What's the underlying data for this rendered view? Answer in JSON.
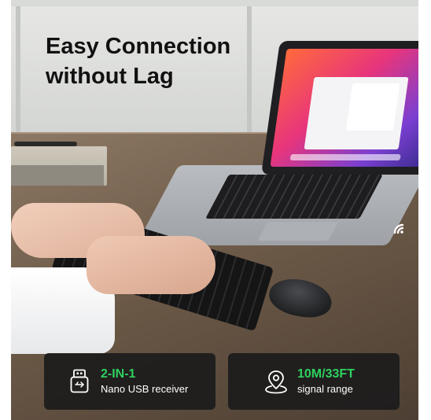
{
  "headline": {
    "line1": "Easy Connection",
    "line2": "without Lag"
  },
  "features": [
    {
      "title": "2-IN-1",
      "subtitle": "Nano USB receiver",
      "icon": "usb-receiver-icon"
    },
    {
      "title": "10M/33FT",
      "subtitle": "signal range",
      "icon": "location-pin-icon"
    }
  ],
  "colors": {
    "accent": "#2fd05f",
    "card_bg": "#1c1c1c",
    "headline": "#111111"
  }
}
